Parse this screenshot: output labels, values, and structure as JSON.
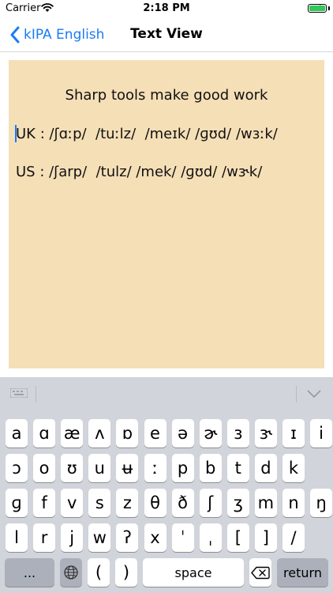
{
  "status_bar": {
    "carrier": "Carrier",
    "time": "2:18 PM",
    "wifi_icon": "wifi-icon",
    "battery_icon": "battery-charging-icon",
    "battery_color": "#34c759"
  },
  "nav": {
    "back_label": "kIPA English",
    "title": "Text View",
    "accent_color": "#1a7cf5"
  },
  "text_view": {
    "background": "#f5dfb7",
    "lines": [
      "Sharp tools make good work",
      "UK : /ʃɑːp/  /tuːlz/  /meɪk/ /ɡʊd/ /wɜːk/",
      "US : /ʃarp/  /tulz/ /mek/ /ɡʊd/ /wɝk/"
    ]
  },
  "keyboard": {
    "rows": [
      [
        "a",
        "ɑ",
        "æ",
        "ʌ",
        "ɒ",
        "e",
        "ə",
        "ɚ",
        "ɜ",
        "ɝ",
        "ɪ",
        "i"
      ],
      [
        "ɔ",
        "o",
        "ʊ",
        "u",
        "ʉ",
        "ː",
        "p",
        "b",
        "t",
        "d",
        "k"
      ],
      [
        "ɡ",
        "f",
        "v",
        "s",
        "z",
        "θ",
        "ð",
        "ʃ",
        "ʒ",
        "m",
        "n",
        "ŋ"
      ],
      [
        "l",
        "r",
        "j",
        "w",
        "ʔ",
        "x",
        "ˈ",
        "ˌ",
        "[",
        "]",
        "/"
      ]
    ],
    "bottom": {
      "dots": "...",
      "globe_icon": "globe-icon",
      "paren_open": "(",
      "paren_close": ")",
      "space": "space",
      "delete_icon": "delete-backspace-icon",
      "return": "return"
    }
  }
}
